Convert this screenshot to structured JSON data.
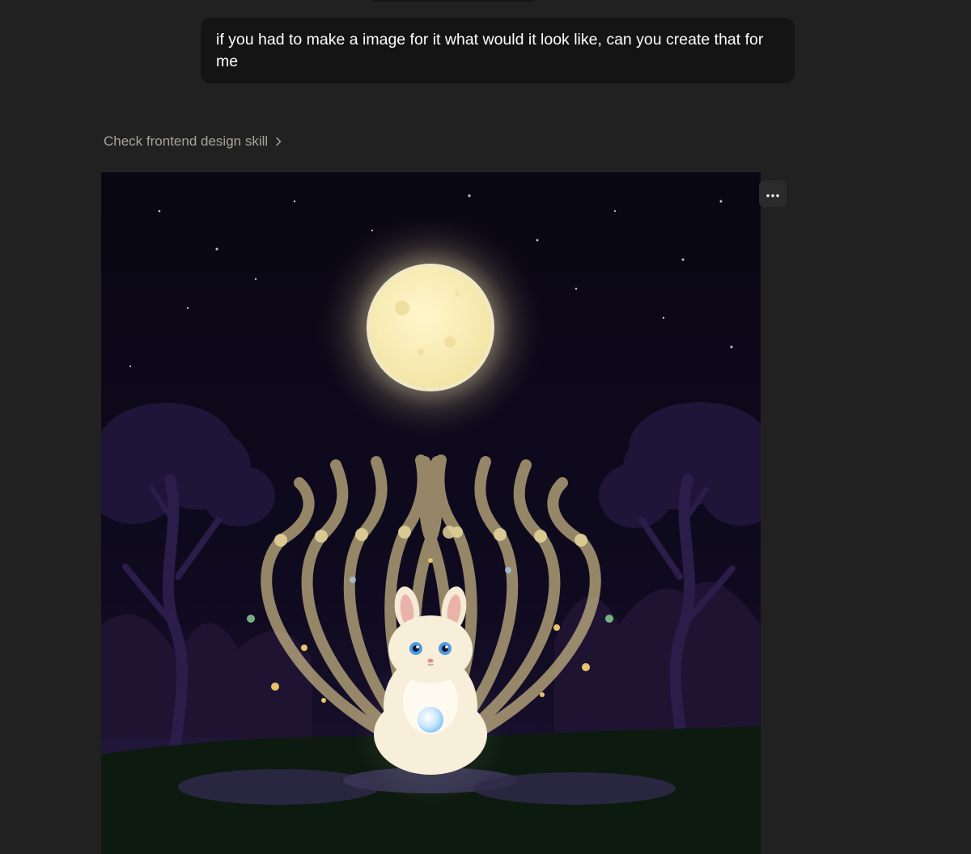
{
  "conversation": {
    "user_message": "if you had to make a image for it what would it look like, can you create that for me",
    "skill_link": {
      "label": "Check frontend design skill",
      "icon": "chevron-right-icon"
    }
  },
  "artifact": {
    "type": "generated-illustration",
    "subjects": [
      "moon-icon",
      "rabbit-icon",
      "tree-icon",
      "star-icon"
    ],
    "menu_icon": "more-horizontal-icon"
  },
  "colors": {
    "page_background": "#212121",
    "bubble_background": "#141414",
    "sky": "#0a0714",
    "moon": "#f7ecb8",
    "tendril": "#c9b684"
  }
}
